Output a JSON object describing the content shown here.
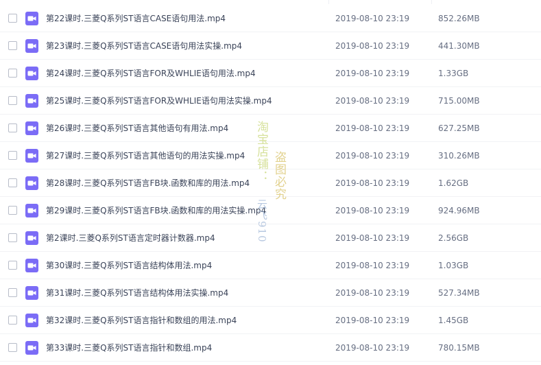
{
  "files": [
    {
      "name": "第22课时.三菱Q系列ST语言CASE语句用法.mp4",
      "date": "2019-08-10 23:19",
      "size": "852.26MB"
    },
    {
      "name": "第23课时.三菱Q系列ST语言CASE语句用法实操.mp4",
      "date": "2019-08-10 23:19",
      "size": "441.30MB"
    },
    {
      "name": "第24课时.三菱Q系列ST语言FOR及WHLIE语句用法.mp4",
      "date": "2019-08-10 23:19",
      "size": "1.33GB"
    },
    {
      "name": "第25课时.三菱Q系列ST语言FOR及WHLIE语句用法实操.mp4",
      "date": "2019-08-10 23:19",
      "size": "715.00MB"
    },
    {
      "name": "第26课时.三菱Q系列ST语言其他语句有用法.mp4",
      "date": "2019-08-10 23:19",
      "size": "627.25MB"
    },
    {
      "name": "第27课时.三菱Q系列ST语言其他语句的用法实操.mp4",
      "date": "2019-08-10 23:19",
      "size": "310.26MB"
    },
    {
      "name": "第28课时.三菱Q系列ST语言FB块.函数和库的用法.mp4",
      "date": "2019-08-10 23:19",
      "size": "1.62GB"
    },
    {
      "name": "第29课时.三菱Q系列ST语言FB块.函数和库的用法实操.mp4",
      "date": "2019-08-10 23:19",
      "size": "924.96MB"
    },
    {
      "name": "第2课时.三菱Q系列ST语言定时器计数器.mp4",
      "date": "2019-08-10 23:19",
      "size": "2.56GB"
    },
    {
      "name": "第30课时.三菱Q系列ST语言结构体用法.mp4",
      "date": "2019-08-10 23:19",
      "size": "1.03GB"
    },
    {
      "name": "第31课时.三菱Q系列ST语言结构体用法实操.mp4",
      "date": "2019-08-10 23:19",
      "size": "527.34MB"
    },
    {
      "name": "第32课时.三菱Q系列ST语言指针和数组的用法.mp4",
      "date": "2019-08-10 23:19",
      "size": "1.45GB"
    },
    {
      "name": "第33课时.三菱Q系列ST语言指针和数组.mp4",
      "date": "2019-08-10 23:19",
      "size": "780.15MB"
    }
  ],
  "watermark": {
    "line1": "淘宝店铺：",
    "line2": "盗图必究",
    "line3": "云飞910"
  },
  "icon": {
    "name": "video-file-icon",
    "color": "#7b6cf6"
  }
}
